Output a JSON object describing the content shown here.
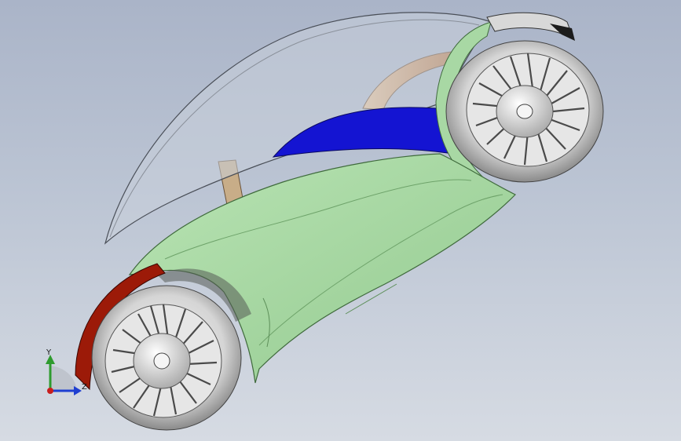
{
  "viewport": {
    "background_top": "#aab4c8",
    "background_bottom": "#d6dbe3"
  },
  "model": {
    "parts": [
      {
        "name": "canopy",
        "color": "#c9d0da"
      },
      {
        "name": "body-shell",
        "color": "#a8d8a4"
      },
      {
        "name": "seat",
        "color": "#1414d2"
      },
      {
        "name": "rear-arch",
        "color": "#d79a68"
      },
      {
        "name": "mudguard-front",
        "color": "#9c1a08"
      },
      {
        "name": "strut",
        "color": "#c8ad88"
      },
      {
        "name": "wheel-front",
        "color": "#d0d0d0"
      },
      {
        "name": "wheel-rear",
        "color": "#d0d0d0"
      }
    ]
  },
  "triad": {
    "y_label": "Y",
    "z_label": "Z",
    "y_color": "#2e9b2e",
    "z_color": "#1f3fd1",
    "x_color": "#c81e1e"
  }
}
